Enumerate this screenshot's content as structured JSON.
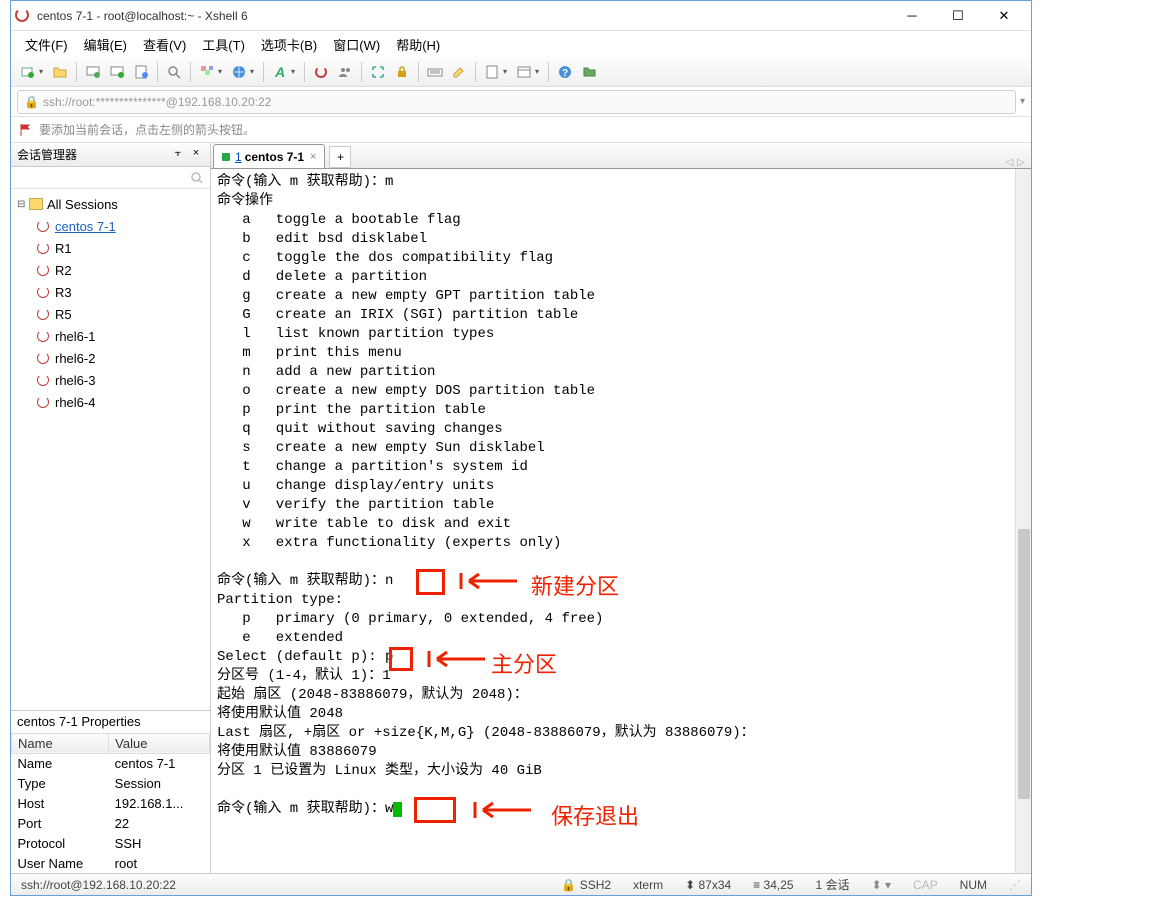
{
  "window": {
    "title": "centos 7-1 - root@localhost:~ - Xshell 6"
  },
  "menubar": {
    "items": [
      "文件(F)",
      "编辑(E)",
      "查看(V)",
      "工具(T)",
      "选项卡(B)",
      "窗口(W)",
      "帮助(H)"
    ]
  },
  "addressbar": {
    "text": "ssh://root:***************@192.168.10.20:22"
  },
  "tipbar": {
    "text": "要添加当前会话，点击左侧的箭头按钮。"
  },
  "session_panel": {
    "title": "会话管理器",
    "root": "All Sessions",
    "items": [
      "centos 7-1",
      "R1",
      "R2",
      "R3",
      "R5",
      "rhel6-1",
      "rhel6-2",
      "rhel6-3",
      "rhel6-4"
    ],
    "selected": "centos 7-1"
  },
  "properties": {
    "title": "centos 7-1 Properties",
    "headers": [
      "Name",
      "Value"
    ],
    "rows": [
      {
        "name": "Name",
        "value": "centos 7-1"
      },
      {
        "name": "Type",
        "value": "Session"
      },
      {
        "name": "Host",
        "value": "192.168.1..."
      },
      {
        "name": "Port",
        "value": "22"
      },
      {
        "name": "Protocol",
        "value": "SSH"
      },
      {
        "name": "User Name",
        "value": "root"
      }
    ]
  },
  "tabs": {
    "active": {
      "num": "1",
      "label": "centos 7-1"
    }
  },
  "terminal": {
    "lines": [
      "命令(输入 m 获取帮助)：m",
      "命令操作",
      "   a   toggle a bootable flag",
      "   b   edit bsd disklabel",
      "   c   toggle the dos compatibility flag",
      "   d   delete a partition",
      "   g   create a new empty GPT partition table",
      "   G   create an IRIX (SGI) partition table",
      "   l   list known partition types",
      "   m   print this menu",
      "   n   add a new partition",
      "   o   create a new empty DOS partition table",
      "   p   print the partition table",
      "   q   quit without saving changes",
      "   s   create a new empty Sun disklabel",
      "   t   change a partition's system id",
      "   u   change display/entry units",
      "   v   verify the partition table",
      "   w   write table to disk and exit",
      "   x   extra functionality (experts only)",
      "",
      "命令(输入 m 获取帮助)：n",
      "Partition type:",
      "   p   primary (0 primary, 0 extended, 4 free)",
      "   e   extended",
      "Select (default p): p",
      "分区号 (1-4，默认 1)：1",
      "起始 扇区 (2048-83886079，默认为 2048)：",
      "将使用默认值 2048",
      "Last 扇区, +扇区 or +size{K,M,G} (2048-83886079，默认为 83886079)：",
      "将使用默认值 83886079",
      "分区 1 已设置为 Linux 类型，大小设为 40 GiB",
      "",
      "命令(输入 m 获取帮助)：w"
    ]
  },
  "annotations": {
    "a1": "新建分区",
    "a2": "主分区",
    "a3": "保存退出"
  },
  "statusbar": {
    "conn": "ssh://root@192.168.10.20:22",
    "ssh": "SSH2",
    "term": "xterm",
    "size": "87x34",
    "pos": "34,25",
    "sess": "1 会话",
    "cap": "CAP",
    "num": "NUM"
  }
}
